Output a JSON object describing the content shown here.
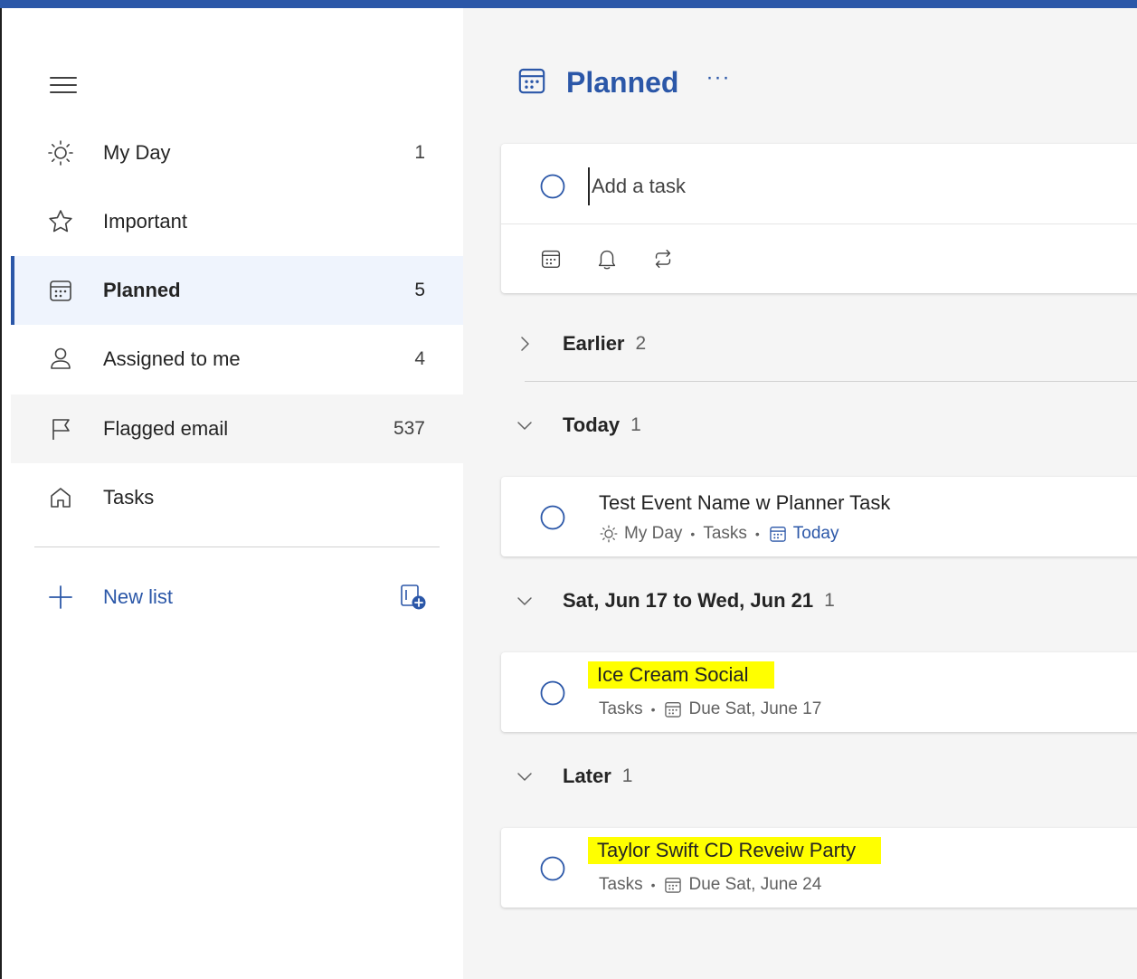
{
  "sidebar": {
    "items": [
      {
        "label": "My Day",
        "count": "1",
        "icon": "sun-icon"
      },
      {
        "label": "Important",
        "count": "",
        "icon": "star-icon"
      },
      {
        "label": "Planned",
        "count": "5",
        "icon": "calendar-icon"
      },
      {
        "label": "Assigned to me",
        "count": "4",
        "icon": "person-icon"
      },
      {
        "label": "Flagged email",
        "count": "537",
        "icon": "flag-icon"
      },
      {
        "label": "Tasks",
        "count": "",
        "icon": "home-icon"
      }
    ],
    "new_list_label": "New list"
  },
  "main": {
    "title": "Planned",
    "more_label": "···",
    "add_task_placeholder": "Add a task",
    "groups": [
      {
        "label": "Earlier",
        "count": "2",
        "expanded": false
      },
      {
        "label": "Today",
        "count": "1",
        "expanded": true
      },
      {
        "label": "Sat, Jun 17 to Wed, Jun 21",
        "count": "1",
        "expanded": true
      },
      {
        "label": "Later",
        "count": "1",
        "expanded": true
      }
    ],
    "tasks": [
      {
        "title": "Test Event Name w Planner Task",
        "myday": "My Day",
        "list": "Tasks",
        "due": "Today"
      },
      {
        "title": "Ice Cream Social",
        "list": "Tasks",
        "due": "Due Sat, June 17"
      },
      {
        "title": "Taylor Swift CD Reveiw Party",
        "list": "Tasks",
        "due": "Due Sat, June 24"
      }
    ]
  },
  "colors": {
    "accent": "#2b57a8",
    "highlight": "#ffff00",
    "selected_bg": "#eff4fd"
  }
}
